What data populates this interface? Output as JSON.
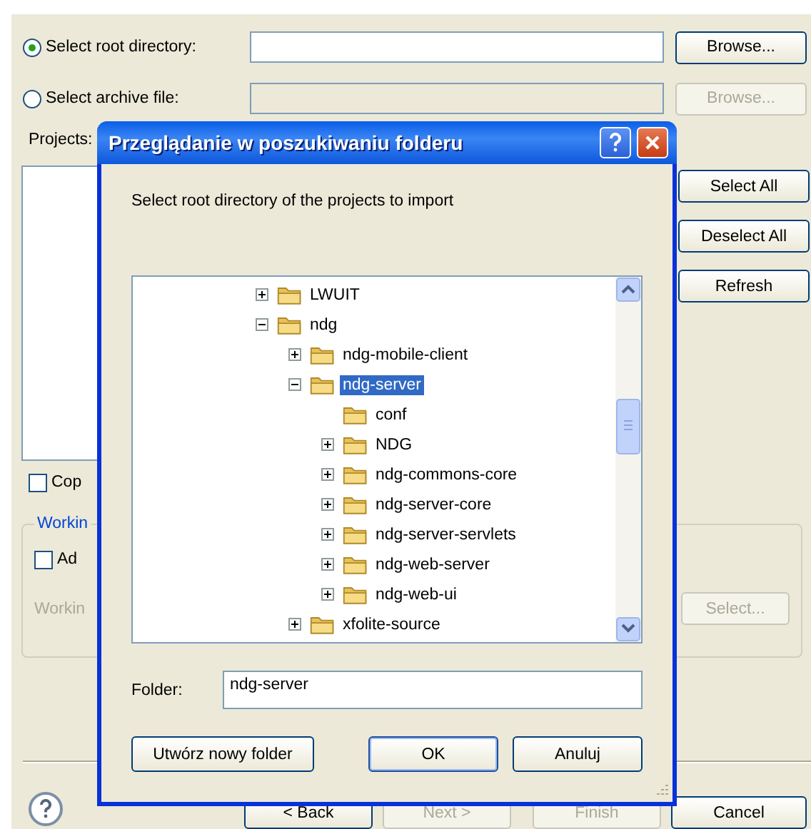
{
  "wizard": {
    "source_options": [
      {
        "label": "Select root directory:",
        "selected": true,
        "disabled": false,
        "browse": "Browse..."
      },
      {
        "label": "Select archive file:",
        "selected": false,
        "disabled": true,
        "browse": "Browse..."
      }
    ],
    "projects_label": "Projects:",
    "project_buttons": [
      "Select All",
      "Deselect All",
      "Refresh"
    ],
    "copy_checkbox": {
      "label": "Cop",
      "checked": false
    },
    "working_sets": {
      "title": "Workin",
      "add_checkbox": {
        "label": "Ad",
        "checked": false
      },
      "label": "Workin",
      "select_button": "Select..."
    },
    "footer_buttons": [
      {
        "label": "< Back",
        "disabled": false
      },
      {
        "label": "Next >",
        "disabled": true
      },
      {
        "label": "Finish",
        "disabled": true
      },
      {
        "label": "Cancel",
        "disabled": false
      }
    ]
  },
  "dialog": {
    "title": "Przeglądanie w poszukiwaniu folderu",
    "prompt": "Select root directory of the projects to import",
    "tree": [
      {
        "label": "LWUIT",
        "kind": "expandable",
        "expanded": false,
        "selected": false
      },
      {
        "label": "ndg",
        "kind": "expandable",
        "expanded": true,
        "selected": false,
        "children": [
          {
            "label": "ndg-mobile-client",
            "kind": "expandable",
            "expanded": false,
            "selected": false
          },
          {
            "label": "ndg-server",
            "kind": "expandable",
            "expanded": true,
            "selected": true,
            "children": [
              {
                "label": "conf",
                "kind": "leaf",
                "selected": false
              },
              {
                "label": "NDG",
                "kind": "expandable",
                "expanded": false,
                "selected": false
              },
              {
                "label": "ndg-commons-core",
                "kind": "expandable",
                "expanded": false,
                "selected": false
              },
              {
                "label": "ndg-server-core",
                "kind": "expandable",
                "expanded": false,
                "selected": false
              },
              {
                "label": "ndg-server-servlets",
                "kind": "expandable",
                "expanded": false,
                "selected": false
              },
              {
                "label": "ndg-web-server",
                "kind": "expandable",
                "expanded": false,
                "selected": false
              },
              {
                "label": "ndg-web-ui",
                "kind": "expandable",
                "expanded": false,
                "selected": false
              }
            ]
          },
          {
            "label": "xfolite-source",
            "kind": "expandable",
            "expanded": false,
            "selected": false
          }
        ]
      }
    ],
    "folder_label": "Folder:",
    "folder_value": "ndg-server",
    "buttons": [
      {
        "label": "Utwórz nowy folder",
        "default": false
      },
      {
        "label": "OK",
        "default": true
      },
      {
        "label": "Anuluj",
        "default": false
      }
    ]
  }
}
